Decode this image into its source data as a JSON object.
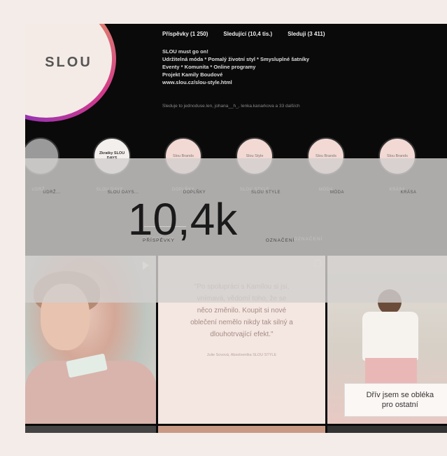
{
  "profile": {
    "logo_text": "SLOU",
    "stats": [
      "Příspěvky (1 250)",
      "Sledující (10,4 tis.)",
      "Sleduji (3 411)"
    ],
    "bio_lines": [
      "SLOU must go on!",
      "Udržitelná móda * Pomalý životní styl * Smysluplné šatníky",
      "Eventy * Komunita * Online programy",
      "Projekt Kamily Boudové",
      "www.slou.cz/slou-style.html"
    ],
    "followed_by": "Sleduje to jednoduse.len, johana__h_, lenka.kanarkova a 33 dalších"
  },
  "highlights": [
    {
      "circle": "",
      "label": "UDRŽ..."
    },
    {
      "circle": "Zkratky SLOU DAYS",
      "label": "SLOU DAYS..."
    },
    {
      "circle": "Slou Brands",
      "label": "DOPLŇKY"
    },
    {
      "circle": "Slou Style",
      "label": "SLOU STYLE"
    },
    {
      "circle": "Slou Brands",
      "label": "MÓDA"
    },
    {
      "circle": "Slou Brands",
      "label": "KRÁSA"
    }
  ],
  "tabs": [
    "PŘÍSPĚVKY",
    "OZNAČENÍ"
  ],
  "overlay": {
    "count": "10,4k"
  },
  "posts": {
    "quote_text": "\"Po spolupráci s Kamilou si jsi, vnímavá, vědomí toho, že se něco změnilo. Koupit si nové oblečení nemělo nikdy tak silný a dlouhotrvající efekt.\"",
    "quote_author": "Julie Sovová, Absolventka SLOU STYLE",
    "caption_line1": "Dřív jsem se obléka",
    "caption_line2": "pro ostatní"
  }
}
